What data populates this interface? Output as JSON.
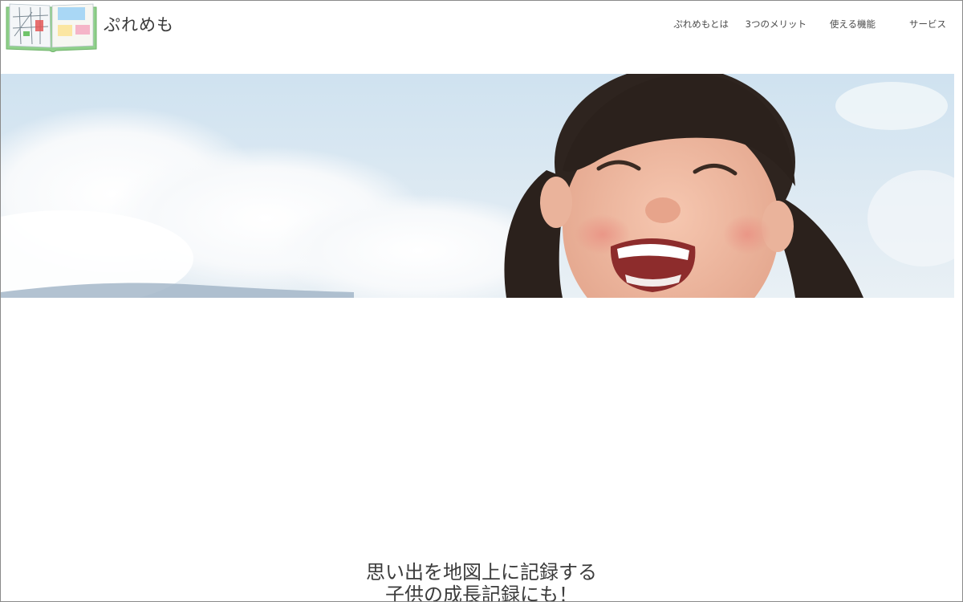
{
  "header": {
    "brand_name": "ぷれめも",
    "logo_icon": "open-book-map-icon"
  },
  "nav": {
    "items": [
      {
        "label": "ぷれめもとは"
      },
      {
        "label": "3つのメリット"
      },
      {
        "label": "使える機能"
      },
      {
        "label": "サービス"
      }
    ]
  },
  "hero": {
    "image": "smiling-girl-photo"
  },
  "tagline": {
    "line1": "思い出を地図上に記録する",
    "line2": "子供の成長記録にも！"
  },
  "colors": {
    "sky": "#dbe8f2",
    "text": "#3c3c3c",
    "logo_green": "#7fc37a"
  }
}
